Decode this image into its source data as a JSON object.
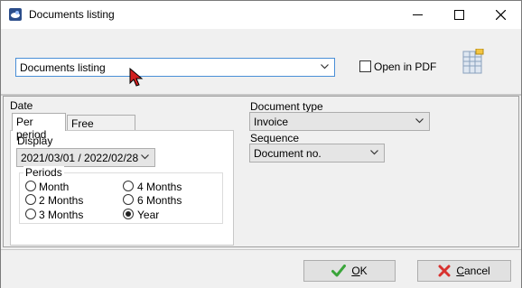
{
  "window": {
    "title": "Documents listing",
    "controls": [
      "minimize",
      "maximize",
      "close"
    ]
  },
  "top": {
    "report_select": {
      "value": "Documents listing"
    },
    "open_in_pdf": {
      "label": "Open in PDF",
      "checked": false
    }
  },
  "date": {
    "label": "Date",
    "tabs": [
      {
        "label": "Per period",
        "active": true
      },
      {
        "label": "Free selection",
        "active": false
      }
    ],
    "display_label": "Display",
    "display_value": "2021/03/01 / 2022/02/28",
    "periods_label": "Periods",
    "periods": [
      {
        "label": "Month",
        "selected": false
      },
      {
        "label": "2 Months",
        "selected": false
      },
      {
        "label": "3 Months",
        "selected": false
      },
      {
        "label": "4 Months",
        "selected": false
      },
      {
        "label": "6 Months",
        "selected": false
      },
      {
        "label": "Year",
        "selected": true
      }
    ]
  },
  "document_type": {
    "label": "Document type",
    "value": "Invoice"
  },
  "sequence": {
    "label": "Sequence",
    "value": "Document no."
  },
  "buttons": {
    "ok_label_pre": "",
    "ok_label_ul": "O",
    "ok_label_post": "K",
    "cancel_label_ul": "C",
    "cancel_label_post": "ancel"
  },
  "colors": {
    "focus_border": "#4a8fd7",
    "ok_icon": "#3aa53a",
    "cancel_icon": "#d8322f"
  }
}
